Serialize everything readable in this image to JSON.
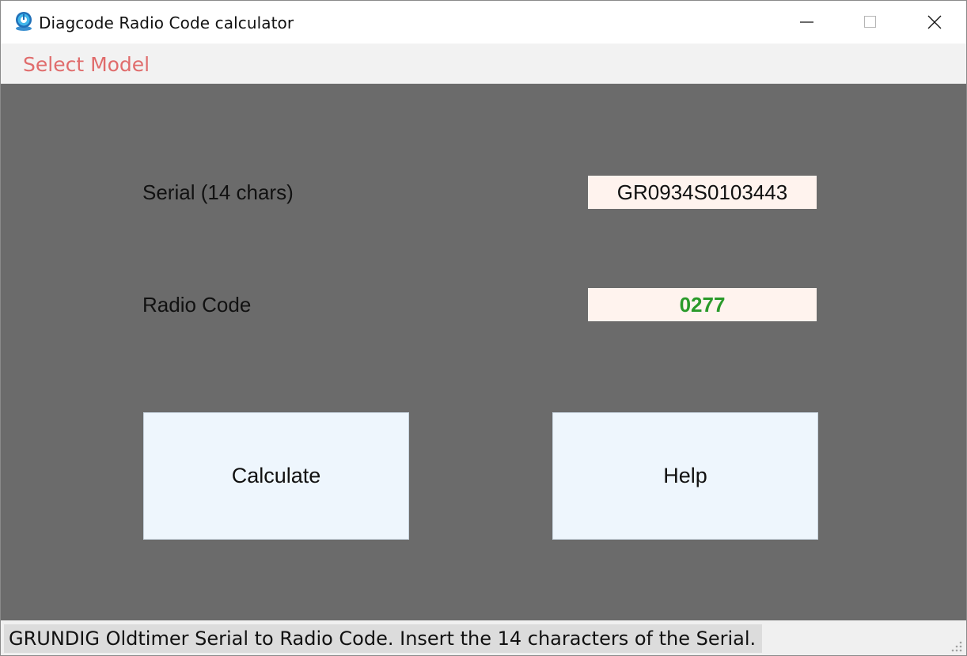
{
  "window": {
    "title": "Diagcode Radio Code calculator",
    "icon": "globe-app-icon"
  },
  "menu": {
    "select_model": "Select Model"
  },
  "form": {
    "serial_label": "Serial (14 chars)",
    "serial_value": "GR0934S0103443",
    "code_label": "Radio Code",
    "code_value": "0277"
  },
  "buttons": {
    "calculate": "Calculate",
    "help": "Help"
  },
  "status": {
    "text": "GRUNDIG Oldtimer Serial to Radio Code. Insert the 14 characters of the Serial."
  },
  "colors": {
    "panel_bg": "#6b6b6b",
    "menu_text": "#e06c6c",
    "code_text": "#2a9a2a",
    "field_bg": "#fff3ee",
    "button_bg": "#eef6fd"
  }
}
